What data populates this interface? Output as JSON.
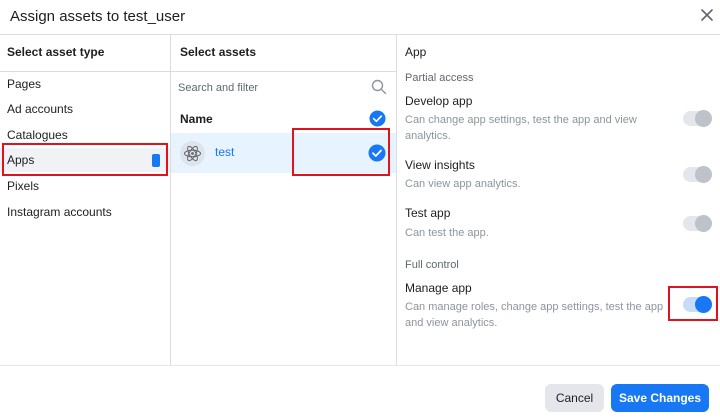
{
  "dialog": {
    "title": "Assign assets to test_user"
  },
  "asset_types": {
    "title": "Select asset type",
    "items": [
      {
        "label": "Pages"
      },
      {
        "label": "Ad accounts"
      },
      {
        "label": "Catalogues"
      },
      {
        "label": "Apps",
        "selected": true
      },
      {
        "label": "Pixels"
      },
      {
        "label": "Instagram accounts"
      }
    ]
  },
  "assets": {
    "title": "Select assets",
    "search_placeholder": "Search and filter",
    "name_header": "Name",
    "rows": [
      {
        "name": "test",
        "checked": true
      }
    ]
  },
  "permissions": {
    "title": "App",
    "partial_label": "Partial access",
    "full_label": "Full control",
    "items": [
      {
        "title": "Develop app",
        "desc": "Can change app settings, test the app and view analytics.",
        "enabled": false
      },
      {
        "title": "View insights",
        "desc": "Can view app analytics.",
        "enabled": false
      },
      {
        "title": "Test app",
        "desc": "Can test the app.",
        "enabled": false
      },
      {
        "title": "Manage app",
        "desc": "Can manage roles, change app settings, test the app and view analytics.",
        "enabled": true
      }
    ]
  },
  "footer": {
    "cancel_label": "Cancel",
    "save_label": "Save Changes"
  },
  "colors": {
    "accent": "#1877f2",
    "highlight": "#e0121d",
    "selected_row": "#e7f3ff"
  }
}
